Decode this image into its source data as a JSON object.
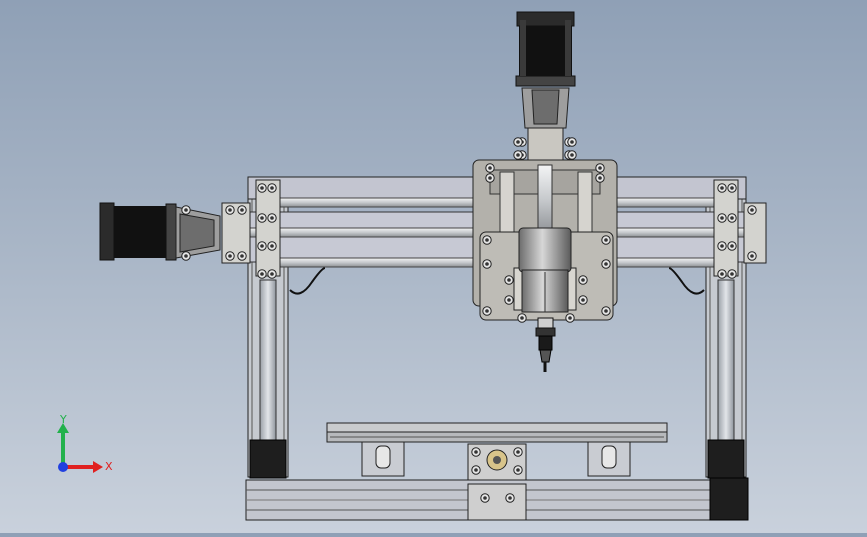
{
  "view": {
    "colors": {
      "background_top": "#8fa0b6",
      "background_bottom": "#c9d1dc",
      "frame_metal": "#c8ccd2",
      "plate_metal": "#b3b1ab",
      "motor_body": "#111111",
      "rod_steel": "#d8dadc",
      "outline": "#2a2a2a"
    }
  },
  "triad": {
    "y_label": "Y",
    "x_label": "X",
    "y_color": "#22b14c",
    "x_color": "#e02020",
    "z_color": "#2040e0"
  }
}
